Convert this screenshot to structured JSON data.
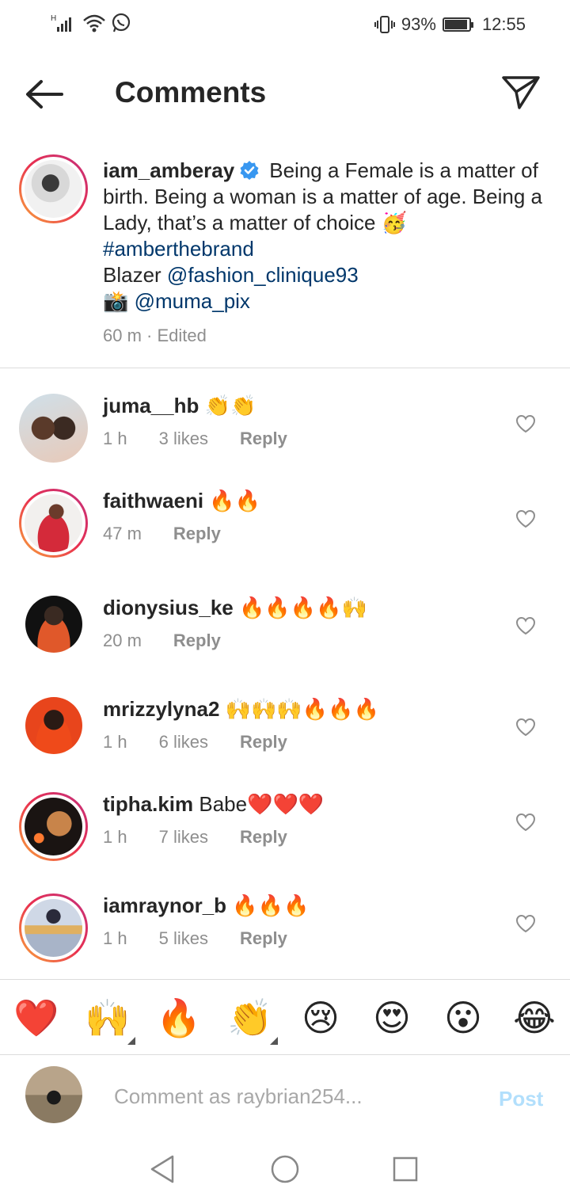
{
  "status_bar": {
    "battery_percent": "93%",
    "battery_level": 0.93,
    "time": "12:55",
    "icons": [
      "signal-icon",
      "wifi-icon",
      "whatsapp-icon",
      "vibrate-icon",
      "battery-icon"
    ]
  },
  "header": {
    "title": "Comments",
    "back_icon": "arrow-left-icon",
    "send_icon": "paper-plane-icon"
  },
  "caption": {
    "username": "iam_amberay",
    "verified": true,
    "text_1": "Being a Female is a matter of birth. Being a woman is a matter of age. Being a Lady, that’s a matter of choice ",
    "emoji_1": "🥳",
    "hashtag": "#amberthebrand",
    "blazer_label": "Blazer ",
    "mention_1": "@fashion_clinique93",
    "camera_emoji": "📸",
    "mention_2": "@muma_pix",
    "time": "60 m",
    "separator": "·",
    "edited": "Edited"
  },
  "comments": [
    {
      "username": "juma__hb",
      "text": "👏👏",
      "time": "1 h",
      "likes": "3 likes",
      "reply": "Reply"
    },
    {
      "username": "faithwaeni",
      "text": "🔥🔥",
      "time": "47 m",
      "likes": "",
      "reply": "Reply"
    },
    {
      "username": "dionysius_ke",
      "text": "🔥🔥🔥🔥🙌",
      "time": "20 m",
      "likes": "",
      "reply": "Reply"
    },
    {
      "username": "mrizzylyna2",
      "text": "🙌🙌🙌🔥🔥🔥",
      "time": "1 h",
      "likes": "6 likes",
      "reply": "Reply"
    },
    {
      "username": "tipha.kim",
      "text": "Babe❤️❤️❤️",
      "time": "1 h",
      "likes": "7 likes",
      "reply": "Reply"
    },
    {
      "username": "iamraynor_b",
      "text": "🔥🔥🔥",
      "time": "1 h",
      "likes": "5 likes",
      "reply": "Reply"
    }
  ],
  "emoji_bar": [
    "❤️",
    "🙌",
    "🔥",
    "👏",
    "😢",
    "😍",
    "😮",
    "😂"
  ],
  "composer": {
    "placeholder": "Comment as raybrian254...",
    "post_label": "Post"
  },
  "colors": {
    "link": "#00376b",
    "meta": "#8e8e8e",
    "post_disabled": "#b2dffc",
    "verified": "#3897f0"
  }
}
